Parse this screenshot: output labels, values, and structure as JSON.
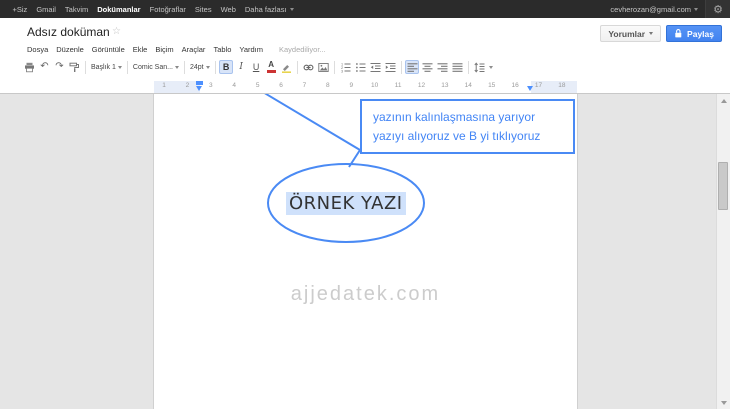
{
  "topbar": {
    "items": [
      "+Siz",
      "Gmail",
      "Takvim",
      "Dokümanlar",
      "Fotoğraflar",
      "Sites",
      "Web",
      "Daha fazlası"
    ],
    "account": "cevherozan@gmail.com"
  },
  "header": {
    "title": "Adsız doküman",
    "star": "☆",
    "comments_label": "Yorumlar",
    "share_label": "Paylaş"
  },
  "menubar": {
    "items": [
      "Dosya",
      "Düzenle",
      "Görüntüle",
      "Ekle",
      "Biçim",
      "Araçlar",
      "Tablo",
      "Yardım"
    ],
    "status": "Kaydediliyor..."
  },
  "toolbar": {
    "style": "Başlık 1",
    "font": "Comic San...",
    "size": "24pt",
    "bold": "B",
    "italic": "I",
    "underline": "U",
    "text_color": "A"
  },
  "icons": {
    "undo": "↶",
    "redo": "↷",
    "gear": "⚙"
  },
  "ruler": {
    "numbers": [
      "1",
      "2",
      "3",
      "4",
      "5",
      "6",
      "7",
      "8",
      "9",
      "10",
      "11",
      "12",
      "13",
      "14",
      "15",
      "16",
      "17",
      "18"
    ]
  },
  "doc": {
    "callout_line1": "yazının kalınlaşmasına yarıyor",
    "callout_line2": "yazıyı alıyoruz ve B yi tıklıyoruz",
    "sample_text": "ÖRNEK YAZI",
    "watermark": "ajjedatek.com"
  },
  "colors": {
    "accent": "#4d90fe",
    "annotation": "#4a8af4",
    "selection": "#cfe1fb",
    "topbar_bg": "#2b2b2b"
  }
}
